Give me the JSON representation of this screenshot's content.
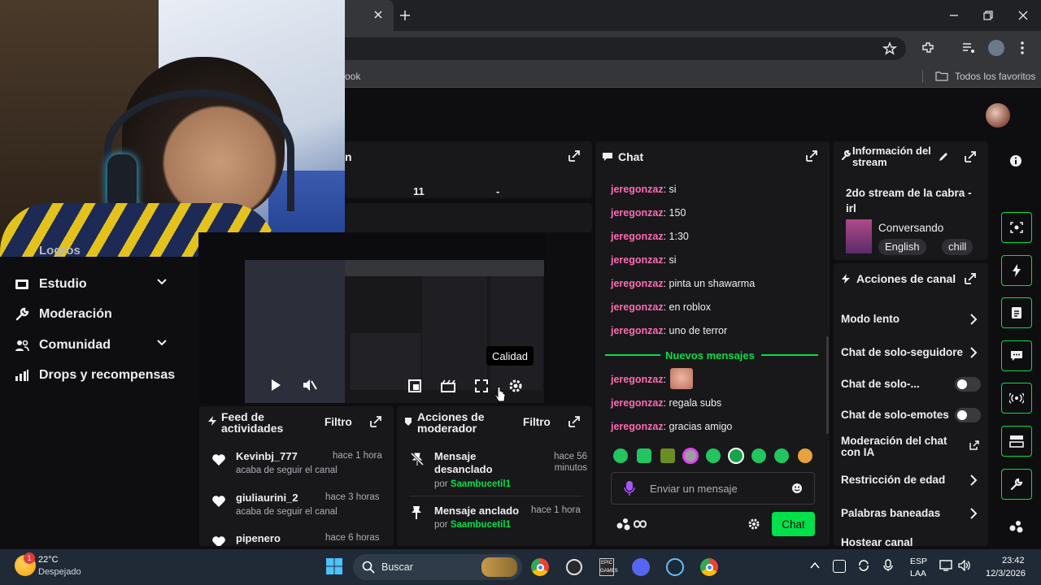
{
  "browser": {
    "bookmark_partial": "ook",
    "bookmarks_all": "Todos los favoritos"
  },
  "webcam_overlay": {
    "sidebar_partial": "Logros"
  },
  "sidebar": {
    "items": [
      {
        "label": "Estudio",
        "icon": "film-icon",
        "chevron": true
      },
      {
        "label": "Moderación",
        "icon": "wrench-icon",
        "chevron": false
      },
      {
        "label": "Comunidad",
        "icon": "people-icon",
        "chevron": true
      },
      {
        "label": "Drops y recompensas",
        "icon": "chart-icon",
        "chevron": false
      }
    ]
  },
  "stats_panel": {
    "title_partial": "n",
    "value1": "11",
    "value2": "-"
  },
  "video": {
    "tooltip": "Calidad"
  },
  "chat": {
    "title": "Chat",
    "messages": [
      {
        "user": "jeregonzaz",
        "text": ": si"
      },
      {
        "user": "jeregonzaz",
        "text": ": 150"
      },
      {
        "user": "jeregonzaz",
        "text": ": 1:30"
      },
      {
        "user": "jeregonzaz",
        "text": ": si"
      },
      {
        "user": "jeregonzaz",
        "text": ": pinta un shawarma"
      },
      {
        "user": "jeregonzaz",
        "text": ": en roblox"
      },
      {
        "user": "jeregonzaz",
        "text": ": uno de terror"
      }
    ],
    "divider": "Nuevos mensajes",
    "new_messages": [
      {
        "user": "jeregonzaz",
        "text": ":"
      },
      {
        "user": "jeregonzaz",
        "text": ": regala subs"
      },
      {
        "user": "jeregonzaz",
        "text": ": gracias amigo"
      }
    ],
    "input_placeholder": "Enviar un mensaje",
    "send_button": "Chat",
    "accent_color": "#00e04a",
    "username_color": "#ff6bb5"
  },
  "stream_info": {
    "title": "Información del stream",
    "stream_title": "2do stream de la cabra - irl",
    "category": "Conversando",
    "tags": [
      "English",
      "chill"
    ]
  },
  "channel_actions": {
    "title": "Acciones de canal",
    "rows": [
      {
        "label": "Modo lento",
        "control": "chevron"
      },
      {
        "label": "Chat de solo-seguidore",
        "control": "chevron"
      },
      {
        "label": "Chat de solo-...",
        "control": "toggle"
      },
      {
        "label": "Chat de solo-emotes",
        "control": "toggle"
      },
      {
        "label": "Moderación del chat con IA",
        "control": "external"
      },
      {
        "label": "Restricción de edad",
        "control": "chevron"
      },
      {
        "label": "Palabras baneadas",
        "control": "chevron"
      },
      {
        "label": "Hostear canal",
        "control": "none"
      }
    ]
  },
  "activity_feed": {
    "title": "Feed de actividades",
    "filter": "Filtro",
    "items": [
      {
        "name": "Kevinbj_777",
        "time": "hace 1 hora",
        "sub": "acaba de seguir el canal"
      },
      {
        "name": "giuliaurini_2",
        "time": "hace 3 horas",
        "sub": "acaba de seguir el canal"
      },
      {
        "name": "pipenero",
        "time": "hace 6 horas",
        "sub": ""
      }
    ]
  },
  "mod_actions": {
    "title": "Acciones de moderador",
    "filter": "Filtro",
    "items": [
      {
        "action": "Mensaje desanclado",
        "time": "hace 56 minutos",
        "by_label": "por",
        "by": "Saambucetil1"
      },
      {
        "action": "Mensaje anclado",
        "time": "hace 1 hora",
        "by_label": "por",
        "by": "Saambucetil1"
      }
    ]
  },
  "taskbar": {
    "weather_temp": "22°C",
    "weather_desc": "Despejado",
    "weather_badge": "1",
    "search_label": "Buscar",
    "lang_top": "ESP",
    "lang_bottom": "LAA",
    "time": "23:42",
    "date": "12/3/2026"
  }
}
